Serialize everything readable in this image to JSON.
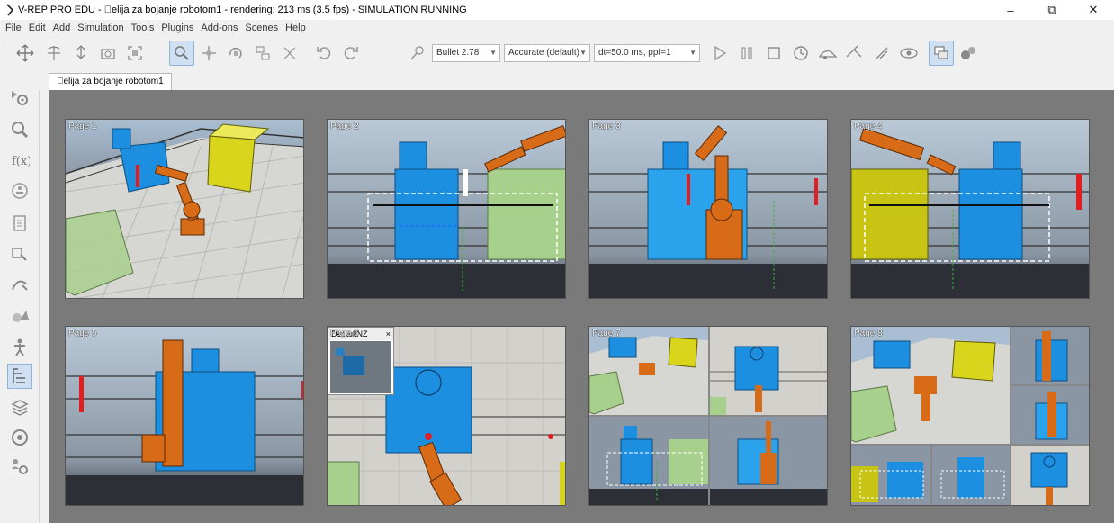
{
  "window": {
    "title": "V-REP PRO EDU - \u0000elija za bojanje robotom1 - rendering: 213 ms (3.5 fps) - SIMULATION RUNNING",
    "minimize": "–",
    "maximize": "⧉",
    "close": "✕"
  },
  "menu": [
    "File",
    "Edit",
    "Add",
    "Simulation",
    "Tools",
    "Plugins",
    "Add-ons",
    "Scenes",
    "Help"
  ],
  "toolbar": {
    "engine": "Bullet 2.78",
    "accuracy": "Accurate (default)",
    "timestep": "dt=50.0 ms, ppf=1"
  },
  "scene_tab": "\u0000elija za bojanje robotom1",
  "pages": [
    {
      "label": "Page 1"
    },
    {
      "label": "Page 2"
    },
    {
      "label": "Page 3"
    },
    {
      "label": "Page 4"
    },
    {
      "label": "Page 5"
    },
    {
      "label": "Page 6",
      "float_title": "DefaultNZ",
      "float_close": "×"
    },
    {
      "label": "Page 7"
    },
    {
      "label": "Page 8"
    }
  ],
  "colors": {
    "viewport_bg": "#7a7a7a",
    "robot": "#d76b17",
    "conveyor_blue": "#1d8fe0",
    "green_box": "#a8d08d",
    "yellow_box": "#d9d51c",
    "sky_top": "#9fb3c8",
    "floor_dark": "#2c2f36"
  }
}
